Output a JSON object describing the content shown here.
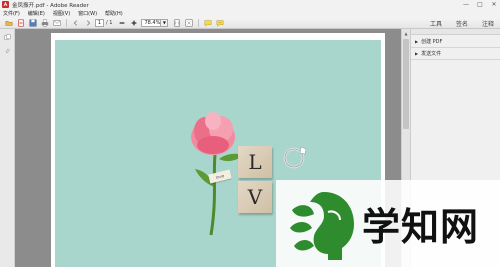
{
  "window": {
    "title": "金凤振开.pdf - Adobe Reader",
    "controls": [
      "—",
      "□",
      "✕"
    ]
  },
  "menu": {
    "items": [
      "文件(F)",
      "编辑(E)",
      "视图(V)",
      "窗口(W)",
      "帮助(H)"
    ]
  },
  "toolbar": {
    "icons": [
      "open-icon",
      "create-icon",
      "save-icon",
      "print-icon",
      "email-icon",
      "prev-page-icon",
      "next-page-icon",
      "zoom-out-icon",
      "zoom-in-icon",
      "fit-page-icon",
      "full-screen-icon",
      "comment-icon",
      "sign-icon"
    ],
    "page_current": "1",
    "page_total": "/ 1",
    "zoom_value": "78.4%",
    "tools_label": "工具",
    "sign_label": "签名",
    "comment_label": "注释"
  },
  "right_panel": {
    "items": [
      "创建 PDF",
      "发送文件"
    ]
  },
  "document": {
    "tiles": [
      "L",
      "V"
    ],
    "tag_text": "love"
  },
  "watermark": {
    "text": "学知网"
  },
  "colors": {
    "photo_background": "#a9d6cc",
    "watermark_green": "#2e8b2e",
    "app_red": "#c9302c"
  }
}
